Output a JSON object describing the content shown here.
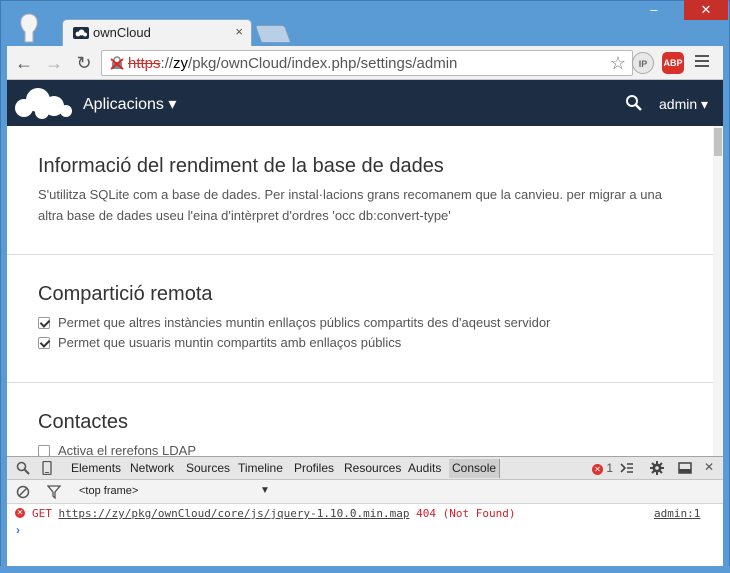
{
  "browser": {
    "tab_title": "ownCloud",
    "tab_close": "×",
    "url_scheme": "https",
    "url_rest": "://zy/pkg/ownCloud/index.php/settings/admin",
    "url_host": "zy",
    "url_path": "/pkg/ownCloud/index.php/settings/admin",
    "ext_ip": "IP",
    "ext_abp": "ABP",
    "win_min": "–",
    "win_max": "▢",
    "win_close": "✕"
  },
  "header": {
    "app_menu": "Aplicacions ▾",
    "user_menu": "admin ▾"
  },
  "sections": {
    "db": {
      "title": "Informació del rendiment de la base de dades",
      "text": "S'utilitza SQLite com a base de dades. Per instal·lacions grans recomanem que la canvieu. per migrar a una altra base de dades useu l'eina d'intèrpret d'ordres 'occ db:convert-type'"
    },
    "sharing": {
      "title": "Compartició remota",
      "option1": "Permet que altres instàncies muntin enllaços públics compartits des d'aqeust servidor",
      "option2": "Permet que usuaris muntin compartits amb enllaços públics",
      "option1_checked": true,
      "option2_checked": true
    },
    "contacts": {
      "title": "Contactes",
      "option1": "Activa el rerefons LDAP",
      "option1_checked": false
    }
  },
  "devtools": {
    "tabs": [
      "Elements",
      "Network",
      "Sources",
      "Timeline",
      "Profiles",
      "Resources",
      "Audits",
      "Console"
    ],
    "active_tab": "Console",
    "error_count": "1",
    "frame": "<top frame>",
    "error": {
      "method": "GET",
      "url": "https://zy/pkg/ownCloud/core/js/jquery-1.10.0.min.map",
      "status": "404 (Not Found)",
      "source": "admin:1"
    },
    "prompt": "›"
  }
}
